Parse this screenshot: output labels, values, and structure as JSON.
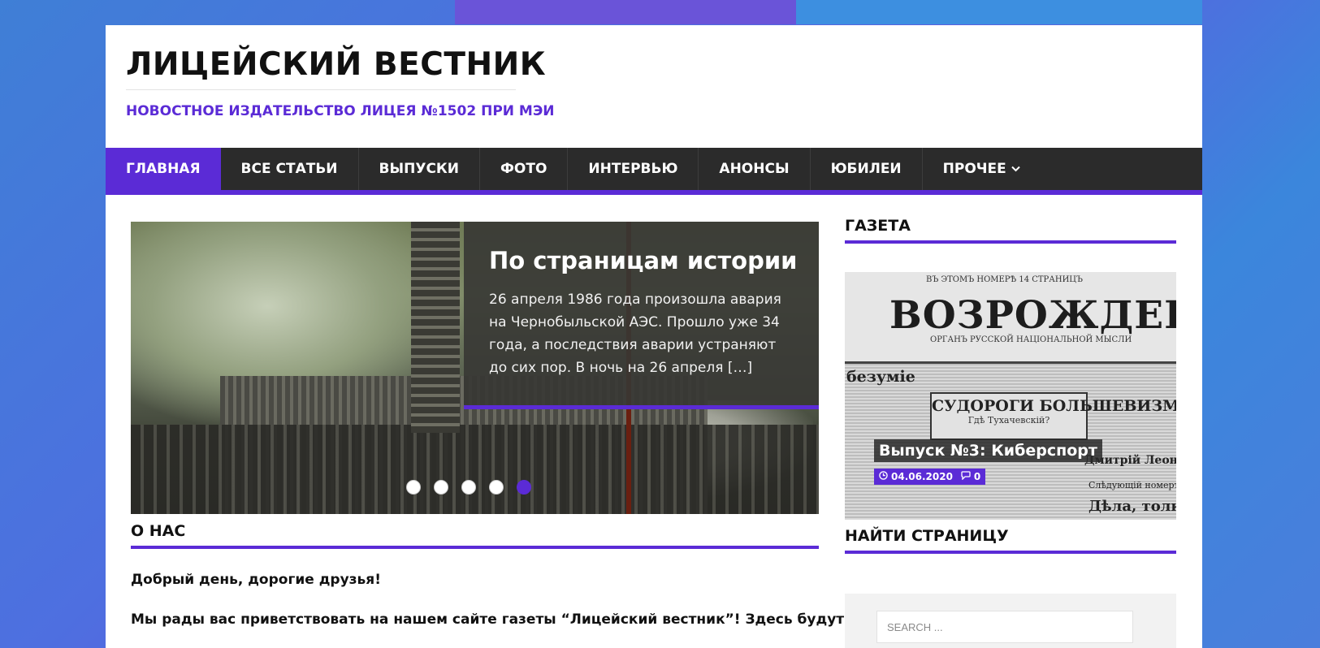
{
  "site": {
    "title": "ЛИЦЕЙСКИЙ ВЕСТНИК",
    "description": "НОВОСТНОЕ ИЗДАТЕЛЬСТВО ЛИЦЕЯ №1502 ПРИ МЭИ"
  },
  "nav": {
    "items": [
      "ГЛАВНАЯ",
      "ВСЕ СТАТЬИ",
      "ВЫПУСКИ",
      "ФОТО",
      "ИНТЕРВЬЮ",
      "АНОНСЫ",
      "ЮБИЛЕИ",
      "ПРОЧЕЕ"
    ],
    "active_index": 0
  },
  "slider": {
    "title": "По страницам истории",
    "excerpt": "26 апреля 1986 года произошла авария на Чернобыльской АЭС. Прошло уже 34 года, а последствия аварии устраняют до сих пор. В ночь на 26 апреля […]",
    "dots_count": 5,
    "active_dot": 5
  },
  "sidebar": {
    "gazeta_title": "ГАЗЕТА",
    "newspaper": {
      "masthead": "ВОЗРОЖДЕНIЕ",
      "headline": "СУДОРОГИ БОЛЬШЕВИЗМА"
    },
    "issue": {
      "title": "Выпуск №3: Киберспорт",
      "date": "04.06.2020",
      "comments": "0"
    },
    "search_title": "НАЙТИ СТРАНИЦУ",
    "search_placeholder": "SEARCH ..."
  },
  "about": {
    "title": "О НАС",
    "greeting": "Добрый день, дорогие друзья!",
    "text": "Мы рады вас приветствовать на нашем сайте газеты “Лицейский вестник”! Здесь будут"
  },
  "colors": {
    "accent": "#5b2bd6",
    "nav_bg": "#2b2b2b"
  }
}
